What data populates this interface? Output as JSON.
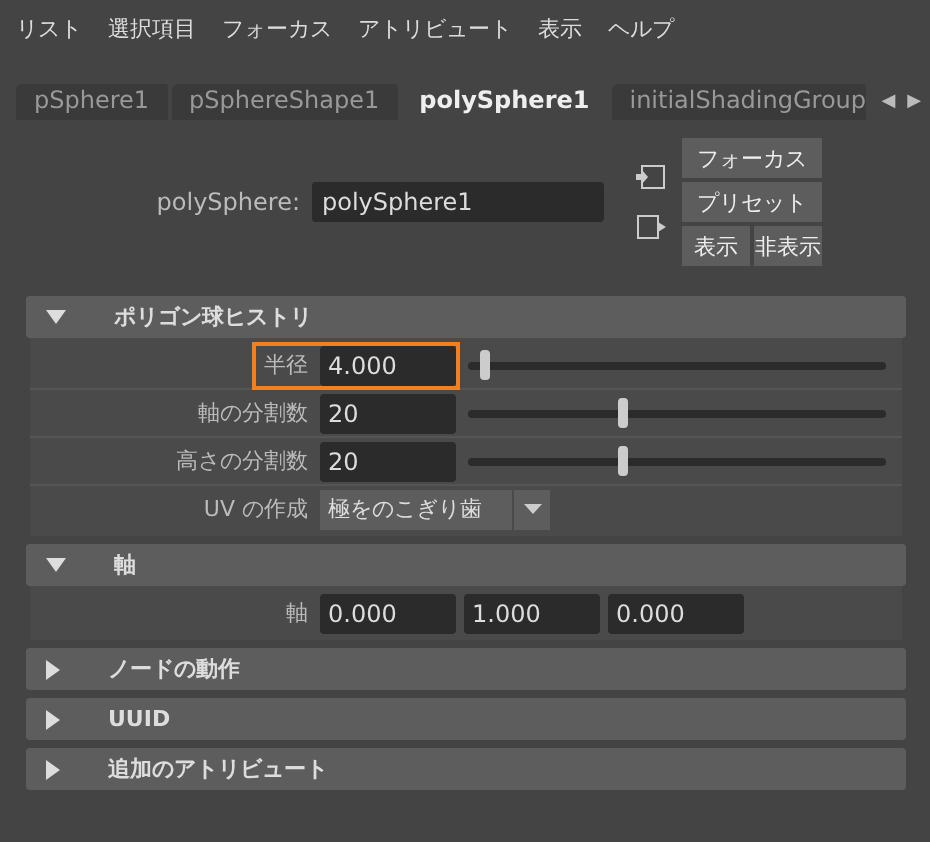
{
  "menu": [
    "リスト",
    "選択項目",
    "フォーカス",
    "アトリビュート",
    "表示",
    "ヘルプ"
  ],
  "tabs": [
    {
      "label": "pSphere1",
      "selected": false
    },
    {
      "label": "pSphereShape1",
      "selected": false
    },
    {
      "label": "polySphere1",
      "selected": true
    },
    {
      "label": "initialShadingGroup",
      "selected": false
    }
  ],
  "tab_scroll": {
    "left": "◀",
    "right": "▶"
  },
  "node": {
    "label": "polySphere:",
    "value": "polySphere1"
  },
  "node_buttons": [
    {
      "label": "フォーカス"
    },
    {
      "label": "プリセット"
    }
  ],
  "node_buttons_row": [
    "表示",
    "非表示"
  ],
  "sections": [
    {
      "title": "ポリゴン球ヒストリ",
      "expanded": true,
      "rows": [
        {
          "kind": "slider",
          "label": "半径",
          "value": "4.000",
          "level": 0.03,
          "highlighted": true
        },
        {
          "kind": "slider",
          "label": "軸の分割数",
          "value": "20",
          "level": 0.37,
          "highlighted": false
        },
        {
          "kind": "slider",
          "label": "高さの分割数",
          "value": "20",
          "level": 0.37,
          "highlighted": false
        },
        {
          "kind": "dropdown",
          "label": "UV の作成",
          "value": "極をのこぎり歯"
        }
      ]
    },
    {
      "title": "軸",
      "expanded": true,
      "rows": [
        {
          "kind": "vector",
          "label": "軸",
          "values": [
            "0.000",
            "1.000",
            "0.000"
          ]
        }
      ]
    },
    {
      "title": "ノードの動作",
      "expanded": false
    },
    {
      "title": "UUID",
      "expanded": false
    },
    {
      "title": "追加のアトリビュート",
      "expanded": false
    }
  ]
}
